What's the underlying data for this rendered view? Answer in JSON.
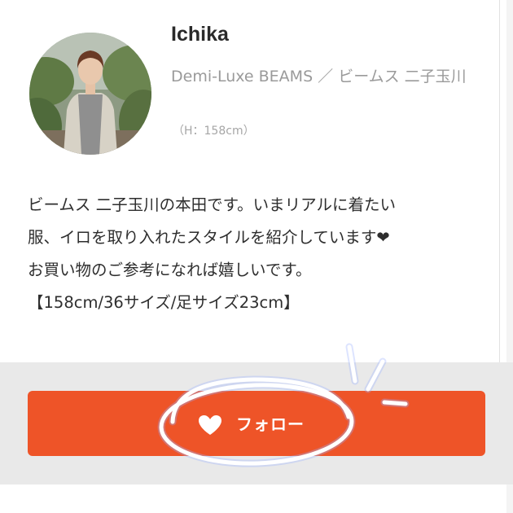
{
  "profile": {
    "name": "Ichika",
    "store": "Demi-Luxe BEAMS ／ ビームス 二子玉川",
    "height": "（H：158cm）"
  },
  "bio": {
    "lines": [
      "ビームス 二子玉川の本田です。いまリアルに着たい",
      "服、イロを取り入れたスタイルを紹介しています❤",
      "お買い物のご参考になれば嬉しいです。",
      "【158cm/36サイズ/足サイズ23cm】"
    ]
  },
  "follow": {
    "label": "フォロー",
    "icon": "heart-icon"
  },
  "colors": {
    "accent": "#ee5428",
    "follow_area_bg": "#e9e9e9",
    "annotation_stroke": "#ffffff"
  }
}
